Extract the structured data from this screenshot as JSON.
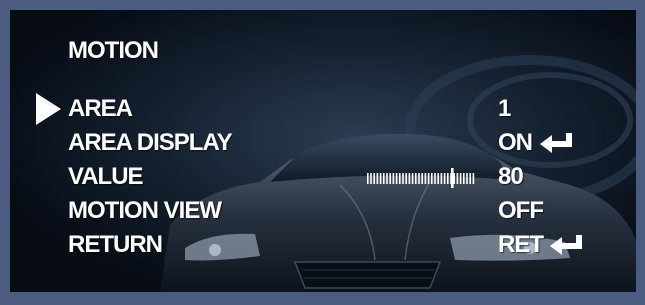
{
  "menu": {
    "title": "MOTION",
    "items": [
      {
        "label": "AREA",
        "value": "1",
        "enter_icon": false,
        "selected": true
      },
      {
        "label": "AREA DISPLAY",
        "value": "ON",
        "enter_icon": true,
        "selected": false
      },
      {
        "label": "VALUE",
        "value": "80",
        "enter_icon": false,
        "selected": false
      },
      {
        "label": "MOTION VIEW",
        "value": "OFF",
        "enter_icon": false,
        "selected": false
      },
      {
        "label": "RETURN",
        "value": "RET",
        "enter_icon": true,
        "selected": false
      }
    ]
  },
  "value_slider": {
    "level": 0.8
  },
  "icons": {
    "cursor": "selection-arrow-icon",
    "enter": "enter-return-icon"
  },
  "colors": {
    "osd_text": "#ffffff",
    "frame_border": "#4b5c80",
    "background": "#08101c"
  }
}
